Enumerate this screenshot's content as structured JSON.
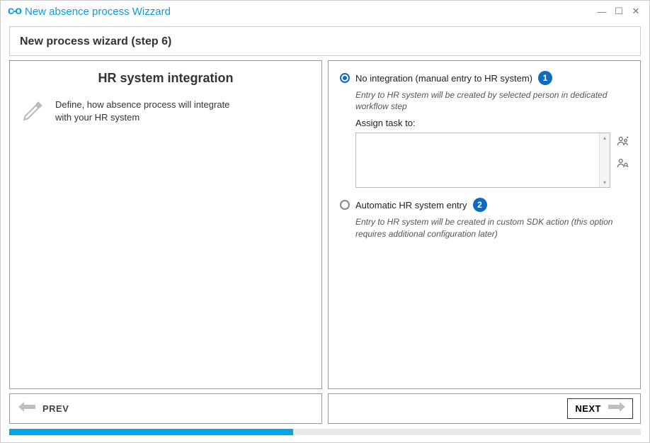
{
  "window": {
    "title": "New absence process Wizzard"
  },
  "header": {
    "title": "New process wizard (step 6)"
  },
  "left": {
    "title": "HR system integration",
    "description": "Define, how absence process will integrate with your HR system"
  },
  "options": {
    "no_integration": {
      "label": "No integration (manual entry to HR system)",
      "badge": "1",
      "hint": "Entry to HR system will be created by selected person in dedicated workflow step",
      "assign_label": "Assign task to:",
      "assign_value": ""
    },
    "automatic": {
      "label": "Automatic HR system entry",
      "badge": "2",
      "hint": "Entry to HR system will be created in custom SDK action (this option requires additional configuration later)"
    }
  },
  "nav": {
    "prev": "PREV",
    "next": "NEXT"
  }
}
